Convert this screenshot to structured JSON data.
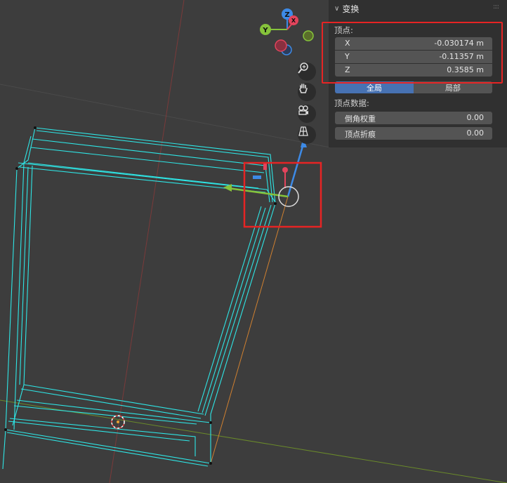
{
  "gizmo": {
    "axis_z": "Z",
    "axis_y": "Y",
    "axis_x": "X"
  },
  "nav_tools": [
    {
      "icon": "zoom-icon"
    },
    {
      "icon": "hand-pan-icon"
    },
    {
      "icon": "camera-icon"
    },
    {
      "icon": "perspective-grid-icon"
    }
  ],
  "transform_panel": {
    "title": "变换",
    "vertex_label": "顶点:",
    "x": {
      "label": "X",
      "value": "-0.030174 m"
    },
    "y": {
      "label": "Y",
      "value": "-0.11357 m"
    },
    "z": {
      "label": "Z",
      "value": "0.3585 m"
    },
    "global_label": "全局",
    "local_label": "局部",
    "vertex_data_label": "顶点数据:",
    "bevel_weight": {
      "label": "倒角权重",
      "value": "0.00"
    },
    "vertex_crease": {
      "label": "顶点折痕",
      "value": "0.00"
    }
  },
  "colors": {
    "viewport_bg": "#3d3d3d",
    "panel_bg": "#303030",
    "field_bg": "#545454",
    "active_toggle": "#4772b3",
    "wireframe": "#2ee6e6",
    "highlight": "#e62424",
    "axis_x": "#e3445c",
    "axis_y": "#86c33b",
    "axis_z": "#3d8ae6"
  }
}
